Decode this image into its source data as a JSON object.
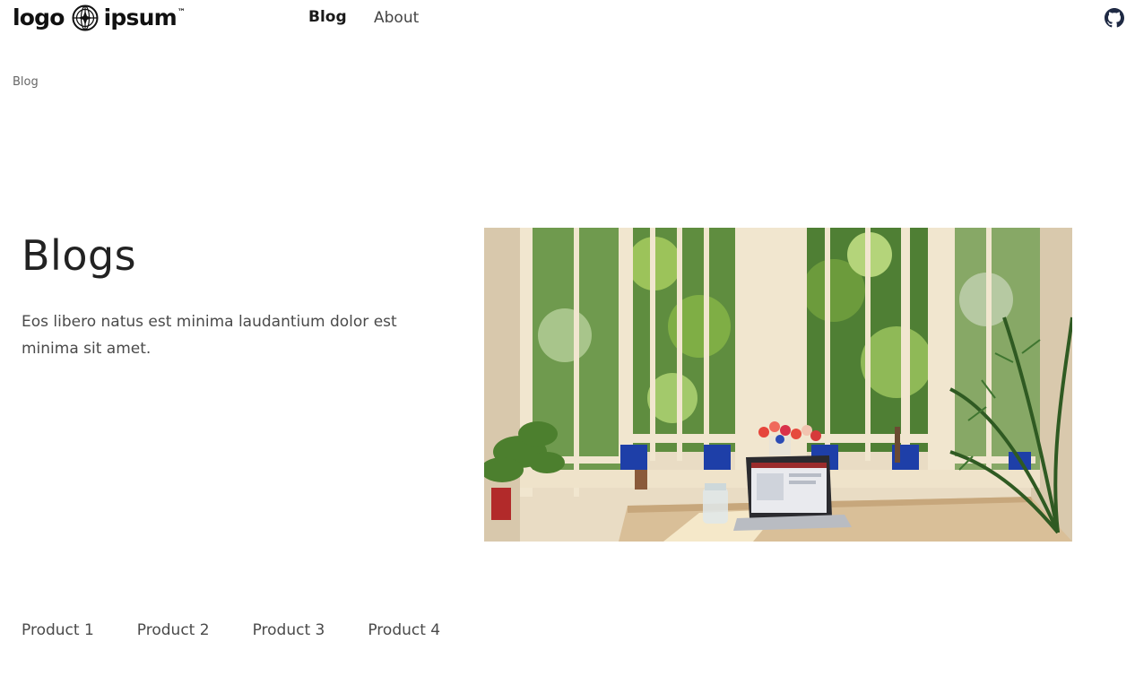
{
  "header": {
    "logo": {
      "left_word": "logo",
      "right_word": "ipsum",
      "trademark": "™"
    },
    "nav": [
      {
        "label": "Blog",
        "active": true
      },
      {
        "label": "About",
        "active": false
      }
    ],
    "github_icon": "github-icon"
  },
  "breadcrumb": {
    "current": "Blog"
  },
  "hero": {
    "title": "Blogs",
    "description": "Eos libero natus est minima laudantium dolor est minima sit amet.",
    "image_subject": "sunlit bay window with desk, laptop, tulips and plants"
  },
  "products": [
    {
      "label": "Product 1"
    },
    {
      "label": "Product 2"
    },
    {
      "label": "Product 3"
    },
    {
      "label": "Product 4"
    }
  ],
  "colors": {
    "text_primary": "#1f1f1f",
    "text_secondary": "#4a4a4a",
    "background": "#ffffff",
    "github": "#1f2a44"
  }
}
